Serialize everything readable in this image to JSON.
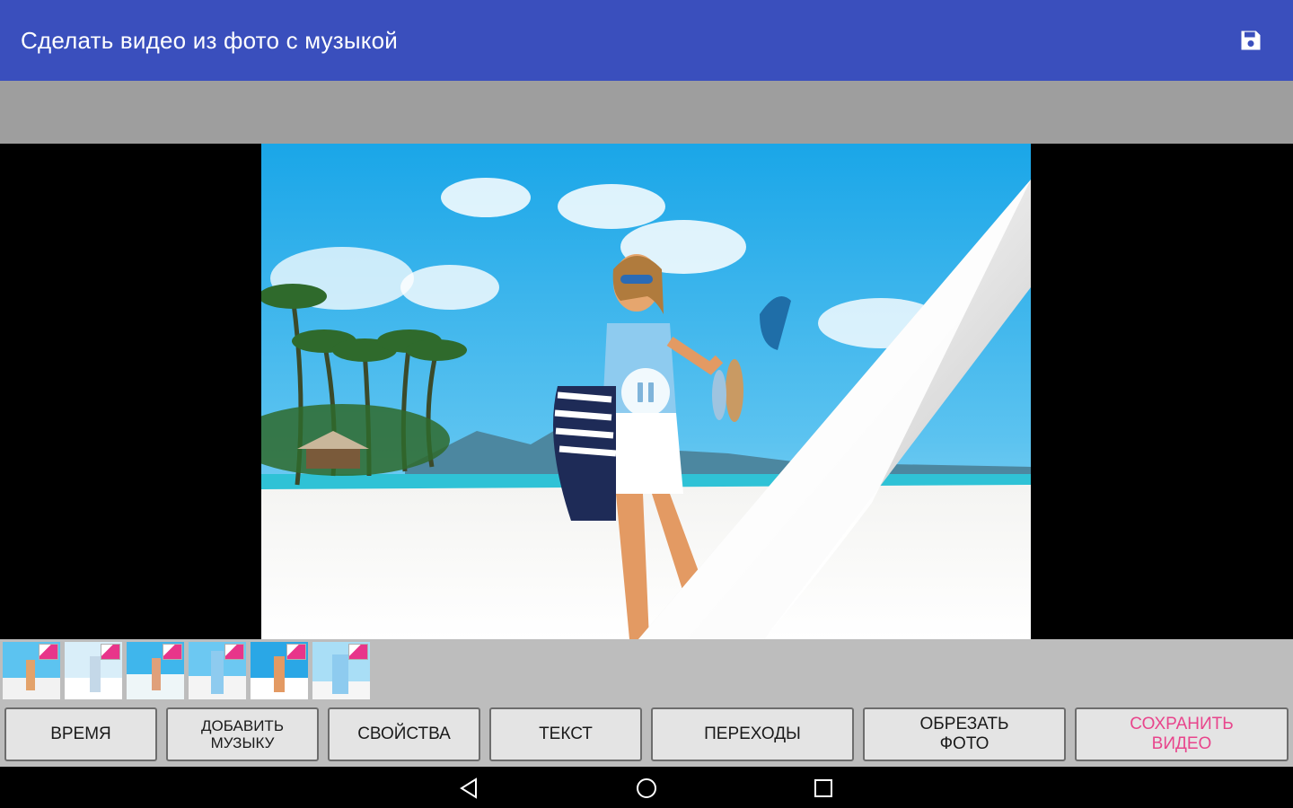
{
  "appbar": {
    "title": "Сделать видео из фото с музыкой",
    "save_icon": "floppy-disk-icon",
    "color": "#3a4fbd"
  },
  "player": {
    "state_icon": "pause-icon"
  },
  "thumbnails": [
    {
      "label": "photo-1"
    },
    {
      "label": "photo-2"
    },
    {
      "label": "photo-3"
    },
    {
      "label": "photo-4"
    },
    {
      "label": "photo-5"
    },
    {
      "label": "photo-6"
    }
  ],
  "toolbar": {
    "time": "ВРЕМЯ",
    "add_music_line1": "ДОБАВИТЬ",
    "add_music_line2": "МУЗЫКУ",
    "properties": "СВОЙСТВА",
    "text": "ТЕКСТ",
    "transitions": "ПЕРЕХОДЫ",
    "crop_line1": "ОБРЕЗАТЬ",
    "crop_line2": "ФОТО",
    "save_line1": "СОХРАНИТЬ",
    "save_line2": "ВИДЕО",
    "accent_color": "#e8458c"
  },
  "navbar": {
    "back_icon": "back-triangle-icon",
    "home_icon": "home-circle-icon",
    "recents_icon": "recents-square-icon"
  }
}
